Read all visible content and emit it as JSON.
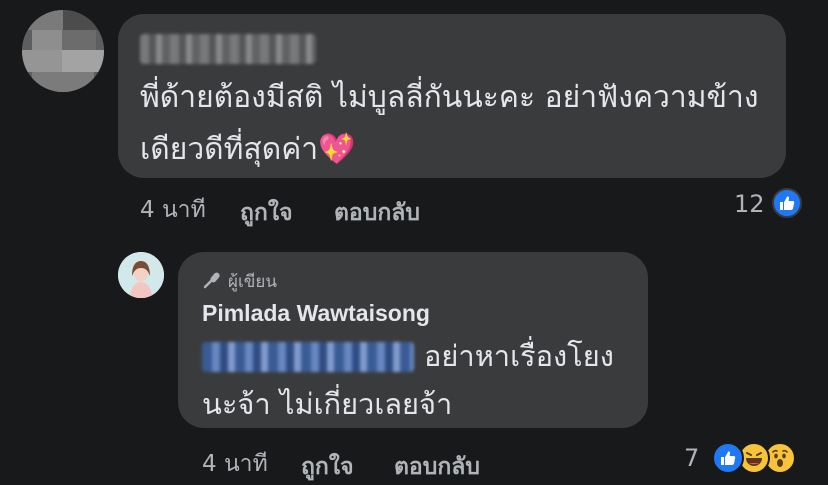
{
  "comment1": {
    "text": "พี่ด้ายต้องมีสติ ไม่บูลลี่กันนะคะ อย่าฟังความข้าง\nเดียวดีที่สุดค่า💖",
    "time": "4 นาที",
    "like_label": "ถูกใจ",
    "reply_label": "ตอบกลับ",
    "reaction_count": "12",
    "reactions": [
      "like"
    ]
  },
  "reply": {
    "badge_label": "ผู้เขียน",
    "author": "Pimlada Wawtaisong",
    "text_line1": "อย่าหาเรื่องโยง",
    "text_line2": "นะจ้า ไม่เกี่ยวเลยจ้า",
    "time": "4 นาที",
    "like_label": "ถูกใจ",
    "reply_label": "ตอบกลับ",
    "reaction_count": "7",
    "reactions": [
      "like",
      "haha",
      "wow"
    ]
  },
  "colors": {
    "background": "#18191a",
    "bubble": "#3a3b3c",
    "text": "#e4e6eb",
    "secondary_text": "#b0b3b8",
    "like_blue": "#2078f4",
    "emoji_yellow": "#f7c33b"
  }
}
